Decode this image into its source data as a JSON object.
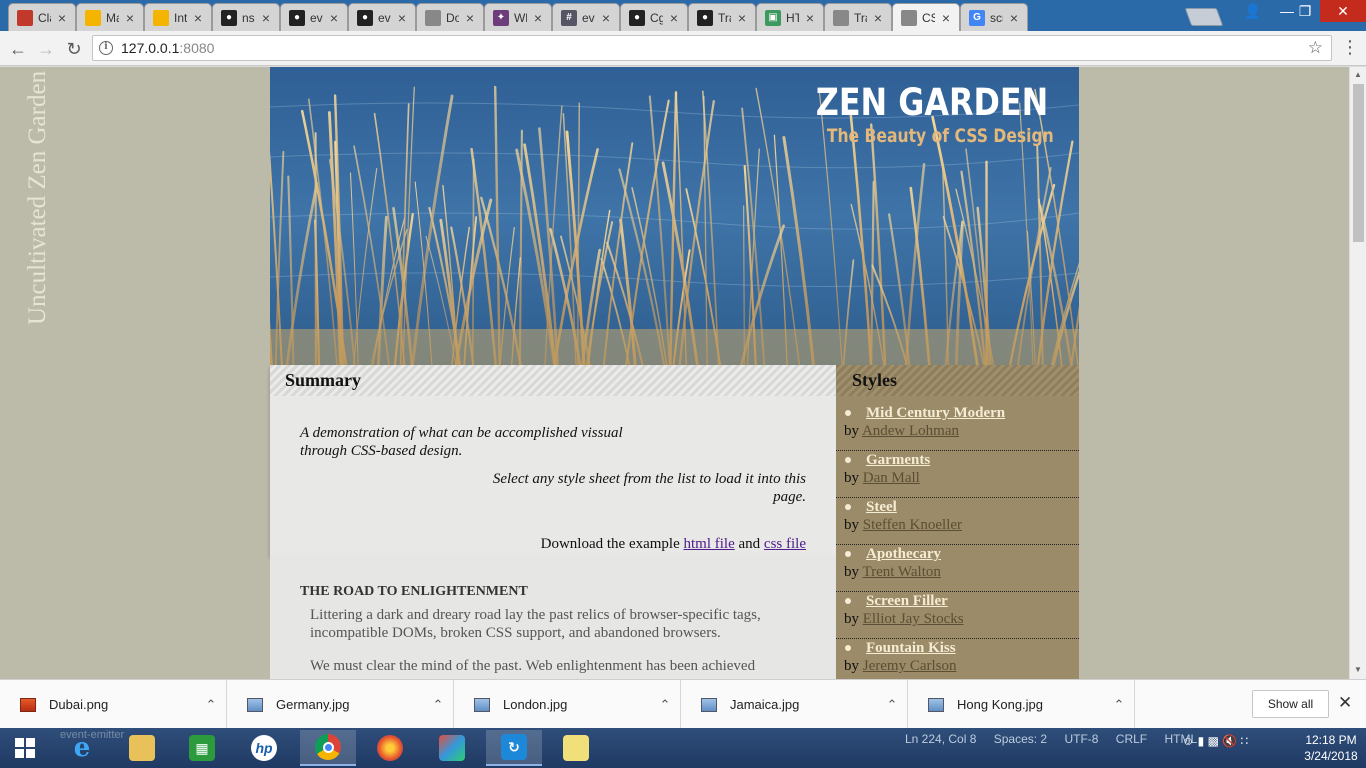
{
  "browser": {
    "tabs": [
      {
        "title": "Cla",
        "icon": "app-icon",
        "color": "#c0392b"
      },
      {
        "title": "Ma",
        "icon": "slides-icon",
        "color": "#f4b400"
      },
      {
        "title": "Inte",
        "icon": "slides-icon",
        "color": "#f4b400"
      },
      {
        "title": "nss",
        "icon": "github-icon",
        "color": "#222222"
      },
      {
        "title": "eve",
        "icon": "github-icon",
        "color": "#222222"
      },
      {
        "title": "eve",
        "icon": "github-icon",
        "color": "#222222"
      },
      {
        "title": "Do",
        "icon": "document-icon",
        "color": "#888888"
      },
      {
        "title": "Wh",
        "icon": "slack-icon",
        "color": "#6c3d7a"
      },
      {
        "title": "eve",
        "icon": "hash-icon",
        "color": "#555566"
      },
      {
        "title": "Cg",
        "icon": "github-icon",
        "color": "#222222"
      },
      {
        "title": "Tra",
        "icon": "github-icon",
        "color": "#222222"
      },
      {
        "title": "HT",
        "icon": "html-icon",
        "color": "#3c9a5f"
      },
      {
        "title": "Tra",
        "icon": "document-icon",
        "color": "#888888"
      },
      {
        "title": "CSS",
        "icon": "document-icon",
        "color": "#888888",
        "active": true
      },
      {
        "title": "scre",
        "icon": "google-icon",
        "color": "#4285f4"
      }
    ],
    "url_host": "127.0.0.1",
    "url_port": ":8080"
  },
  "page": {
    "side_title": "Uncultivated Zen Garden",
    "hero_title": "ZEN GARDEN",
    "hero_subtitle": "The Beauty of CSS Design",
    "summary": {
      "heading": "Summary",
      "p1": "A demonstration of what can be accomplished vissual through CSS-based design.",
      "p2": "Select any style sheet from the list to load it into this page.",
      "download_prefix": "Download the example",
      "html_link": "html file",
      "and": "and",
      "css_link": "css file"
    },
    "styles": {
      "heading": "Styles",
      "by": "by",
      "items": [
        {
          "name": "Mid Century Modern",
          "author": "Andew Lohman"
        },
        {
          "name": "Garments",
          "author": "Dan Mall"
        },
        {
          "name": "Steel",
          "author": "Steffen Knoeller"
        },
        {
          "name": "Apothecary",
          "author": "Trent Walton"
        },
        {
          "name": "Screen Filler",
          "author": "Elliot Jay Stocks"
        },
        {
          "name": "Fountain Kiss",
          "author": "Jeremy Carlson"
        }
      ]
    },
    "road": {
      "heading": "THE ROAD TO ENLIGHTENMENT",
      "p1": "Littering a dark and dreary road lay the past relics of browser-specific tags, incompatible DOMs, broken CSS support, and abandoned browsers.",
      "p2": "We must clear the mind of the past. Web enlightenment has been achieved"
    }
  },
  "downloads": {
    "items": [
      {
        "file": "Dubai.png"
      },
      {
        "file": "Germany.jpg"
      },
      {
        "file": "London.jpg"
      },
      {
        "file": "Jamaica.jpg"
      },
      {
        "file": "Hong Kong.jpg"
      }
    ],
    "show_all": "Show all"
  },
  "taskbar": {
    "ghost_text": "event-emitter",
    "editor_status": [
      "Ln 224, Col 8",
      "Spaces: 2",
      "UTF-8",
      "CRLF",
      "HTML"
    ],
    "time": "12:18 PM",
    "date": "3/24/2018"
  }
}
